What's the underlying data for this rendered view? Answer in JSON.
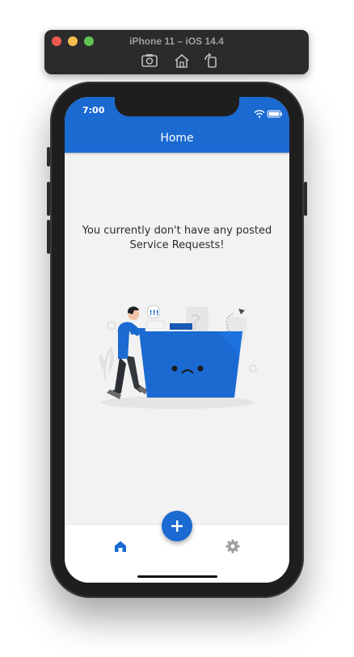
{
  "simulator": {
    "title": "iPhone 11 – iOS 14.4",
    "buttons": [
      "screenshot-icon",
      "home-icon",
      "rotate-icon"
    ]
  },
  "status_bar": {
    "time": "7:00",
    "icons": [
      "wifi-icon",
      "battery-icon"
    ]
  },
  "app_bar": {
    "title": "Home"
  },
  "empty_state": {
    "message": "You currently don't have any posted Service Requests!",
    "illustration": "empty-folder-illustration"
  },
  "fab": {
    "icon": "plus-icon"
  },
  "bottom_nav": {
    "items": [
      {
        "icon": "home-icon",
        "active": true
      },
      {
        "icon": "gear-icon",
        "active": false
      }
    ]
  },
  "colors": {
    "primary": "#1b6ad1",
    "background": "#f2f2f2",
    "inactive": "#9e9e9e"
  }
}
